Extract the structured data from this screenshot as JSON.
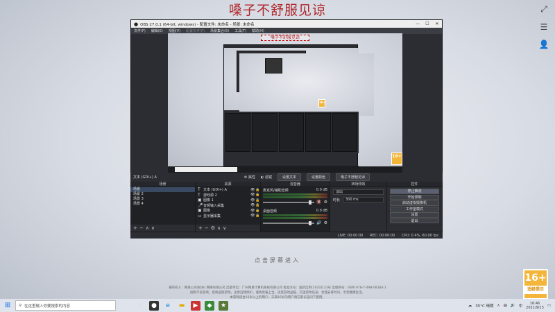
{
  "game": {
    "title": "嗓子不舒服见谅",
    "enter_text": "点击屏幕进入",
    "footer_lines": [
      "著作权人：网易公司(杭州) 网络有限公司  出版单位：广州网易计算机系统有限公司  批准文号：国新出审[2020]123号  出版物号：ISBN 978-7-498-08184-1",
      "抵制不良游戏，拒绝盗版游戏。注意自我保护，谨防受骗上当。适度游戏益脑，沉迷游戏伤身。合理安排时间，享受健康生活。",
      "本游戏适合16岁以上的用户。未满16岁的用户请在家长陪同下使用。"
    ],
    "rating": {
      "age": "16+",
      "label": "适龄提示"
    },
    "right_icons": [
      "expand-icon",
      "menu-icon",
      "user-icon"
    ]
  },
  "obs": {
    "title": "OBS 27.0.1 (64-bit, windows) - 配置文件: 未命名 - 场景: 未命名",
    "menu": [
      "文件(F)",
      "编辑(E)",
      "视图(V)",
      "配置文件(P)",
      "场景集合(S)",
      "工具(T)",
      "帮助(H)"
    ],
    "preview_banner": "嗓子不舒服见谅",
    "source_bar": {
      "current": "文本 (GDI+) A",
      "properties": "属性",
      "filters": "滤镜",
      "text_btn": "设置文本",
      "other_btn": "设置颜色",
      "preview_text": "嗓子不舒服见谅"
    },
    "scenes": {
      "header": "场景",
      "items": [
        "场景",
        "场景 2",
        "场景 3",
        "场景 4"
      ],
      "selected": 0
    },
    "sources": {
      "header": "来源",
      "items": [
        {
          "icon": "T",
          "name": "文本 (GDI+) A"
        },
        {
          "icon": "T",
          "name": "游戏源 2"
        },
        {
          "icon": "▣",
          "name": "图像 1"
        },
        {
          "icon": "🎤",
          "name": "音频输入采集"
        },
        {
          "icon": "▣",
          "name": "图像"
        },
        {
          "icon": "▭",
          "name": "显示器采集"
        }
      ]
    },
    "mixer": {
      "header": "混音器",
      "tracks": [
        {
          "name": "麦克风/辅助音频",
          "db": "0.0 dB"
        },
        {
          "name": "桌面音频",
          "db": "0.0 dB"
        }
      ]
    },
    "transitions": {
      "header": "转场特效",
      "type": "淡出",
      "duration_label": "时长",
      "duration": "300 ms"
    },
    "controls": {
      "header": "控件",
      "buttons": [
        "停止推流",
        "开始录制",
        "启动虚拟摄像机",
        "工作室模式",
        "设置",
        "退出"
      ]
    },
    "status": {
      "live": "LIVE: 00:00:00",
      "rec": "REC: 00:00:00",
      "cpu": "CPU: 0.4%, 60.00 fps"
    }
  },
  "taskbar": {
    "search_placeholder": "在这里输入你要搜索的内容",
    "weather": "35°C 晴朗",
    "time": "16:46",
    "date": "2021/9/13",
    "lang": "中"
  }
}
